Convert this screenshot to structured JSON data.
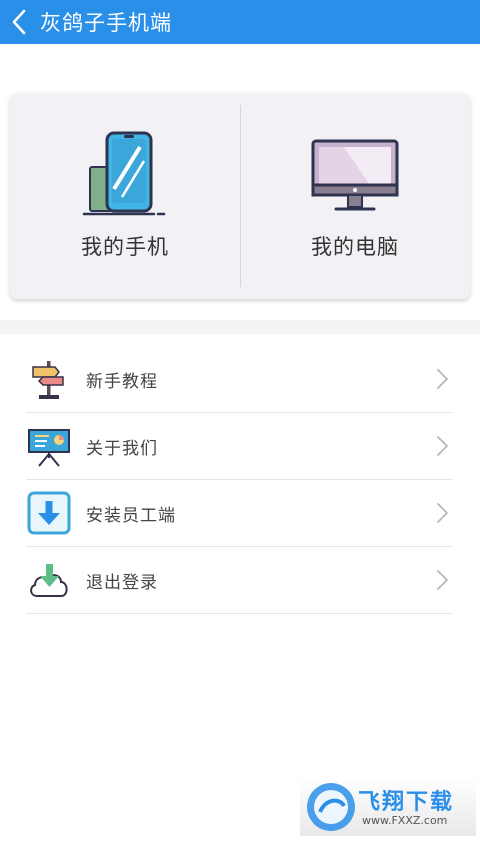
{
  "header": {
    "title": "灰鸽子手机端",
    "back_icon": "chevron-left-icon",
    "background": "#2a8fe8"
  },
  "devices": [
    {
      "label": "我的手机",
      "icon": "phone-icon"
    },
    {
      "label": "我的电脑",
      "icon": "computer-monitor-icon"
    }
  ],
  "menu": {
    "items": [
      {
        "label": "新手教程",
        "icon": "signpost-icon"
      },
      {
        "label": "关于我们",
        "icon": "presentation-board-icon"
      },
      {
        "label": "安装员工端",
        "icon": "download-arrow-icon"
      },
      {
        "label": "退出登录",
        "icon": "cloud-download-icon"
      }
    ],
    "chevron_icon": "chevron-right-icon"
  },
  "watermark": {
    "text": "飞翔下载",
    "url_text": "www.FXXZ.com"
  }
}
